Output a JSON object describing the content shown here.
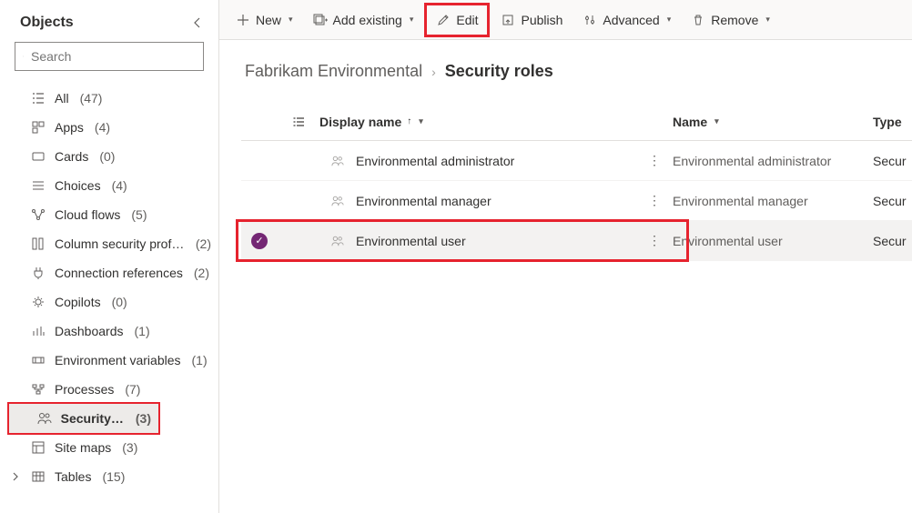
{
  "sidebar": {
    "title": "Objects",
    "search_placeholder": "Search",
    "items": [
      {
        "label": "All",
        "count": "(47)"
      },
      {
        "label": "Apps",
        "count": "(4)"
      },
      {
        "label": "Cards",
        "count": "(0)"
      },
      {
        "label": "Choices",
        "count": "(4)"
      },
      {
        "label": "Cloud flows",
        "count": "(5)"
      },
      {
        "label": "Column security profi...",
        "count": "(2)"
      },
      {
        "label": "Connection references",
        "count": "(2)"
      },
      {
        "label": "Copilots",
        "count": "(0)"
      },
      {
        "label": "Dashboards",
        "count": "(1)"
      },
      {
        "label": "Environment variables",
        "count": "(1)"
      },
      {
        "label": "Processes",
        "count": "(7)"
      },
      {
        "label": "Security roles",
        "count": "(3)"
      },
      {
        "label": "Site maps",
        "count": "(3)"
      },
      {
        "label": "Tables",
        "count": "(15)"
      }
    ]
  },
  "toolbar": {
    "new": "New",
    "add_existing": "Add existing",
    "edit": "Edit",
    "publish": "Publish",
    "advanced": "Advanced",
    "remove": "Remove"
  },
  "breadcrumb": {
    "parent": "Fabrikam Environmental",
    "current": "Security roles"
  },
  "grid": {
    "headers": {
      "display_name": "Display name",
      "name": "Name",
      "type": "Type"
    },
    "rows": [
      {
        "display": "Environmental administrator",
        "name": "Environmental administrator",
        "type": "Secur"
      },
      {
        "display": "Environmental manager",
        "name": "Environmental manager",
        "type": "Secur"
      },
      {
        "display": "Environmental user",
        "name": "Environmental user",
        "type": "Secur"
      }
    ]
  }
}
